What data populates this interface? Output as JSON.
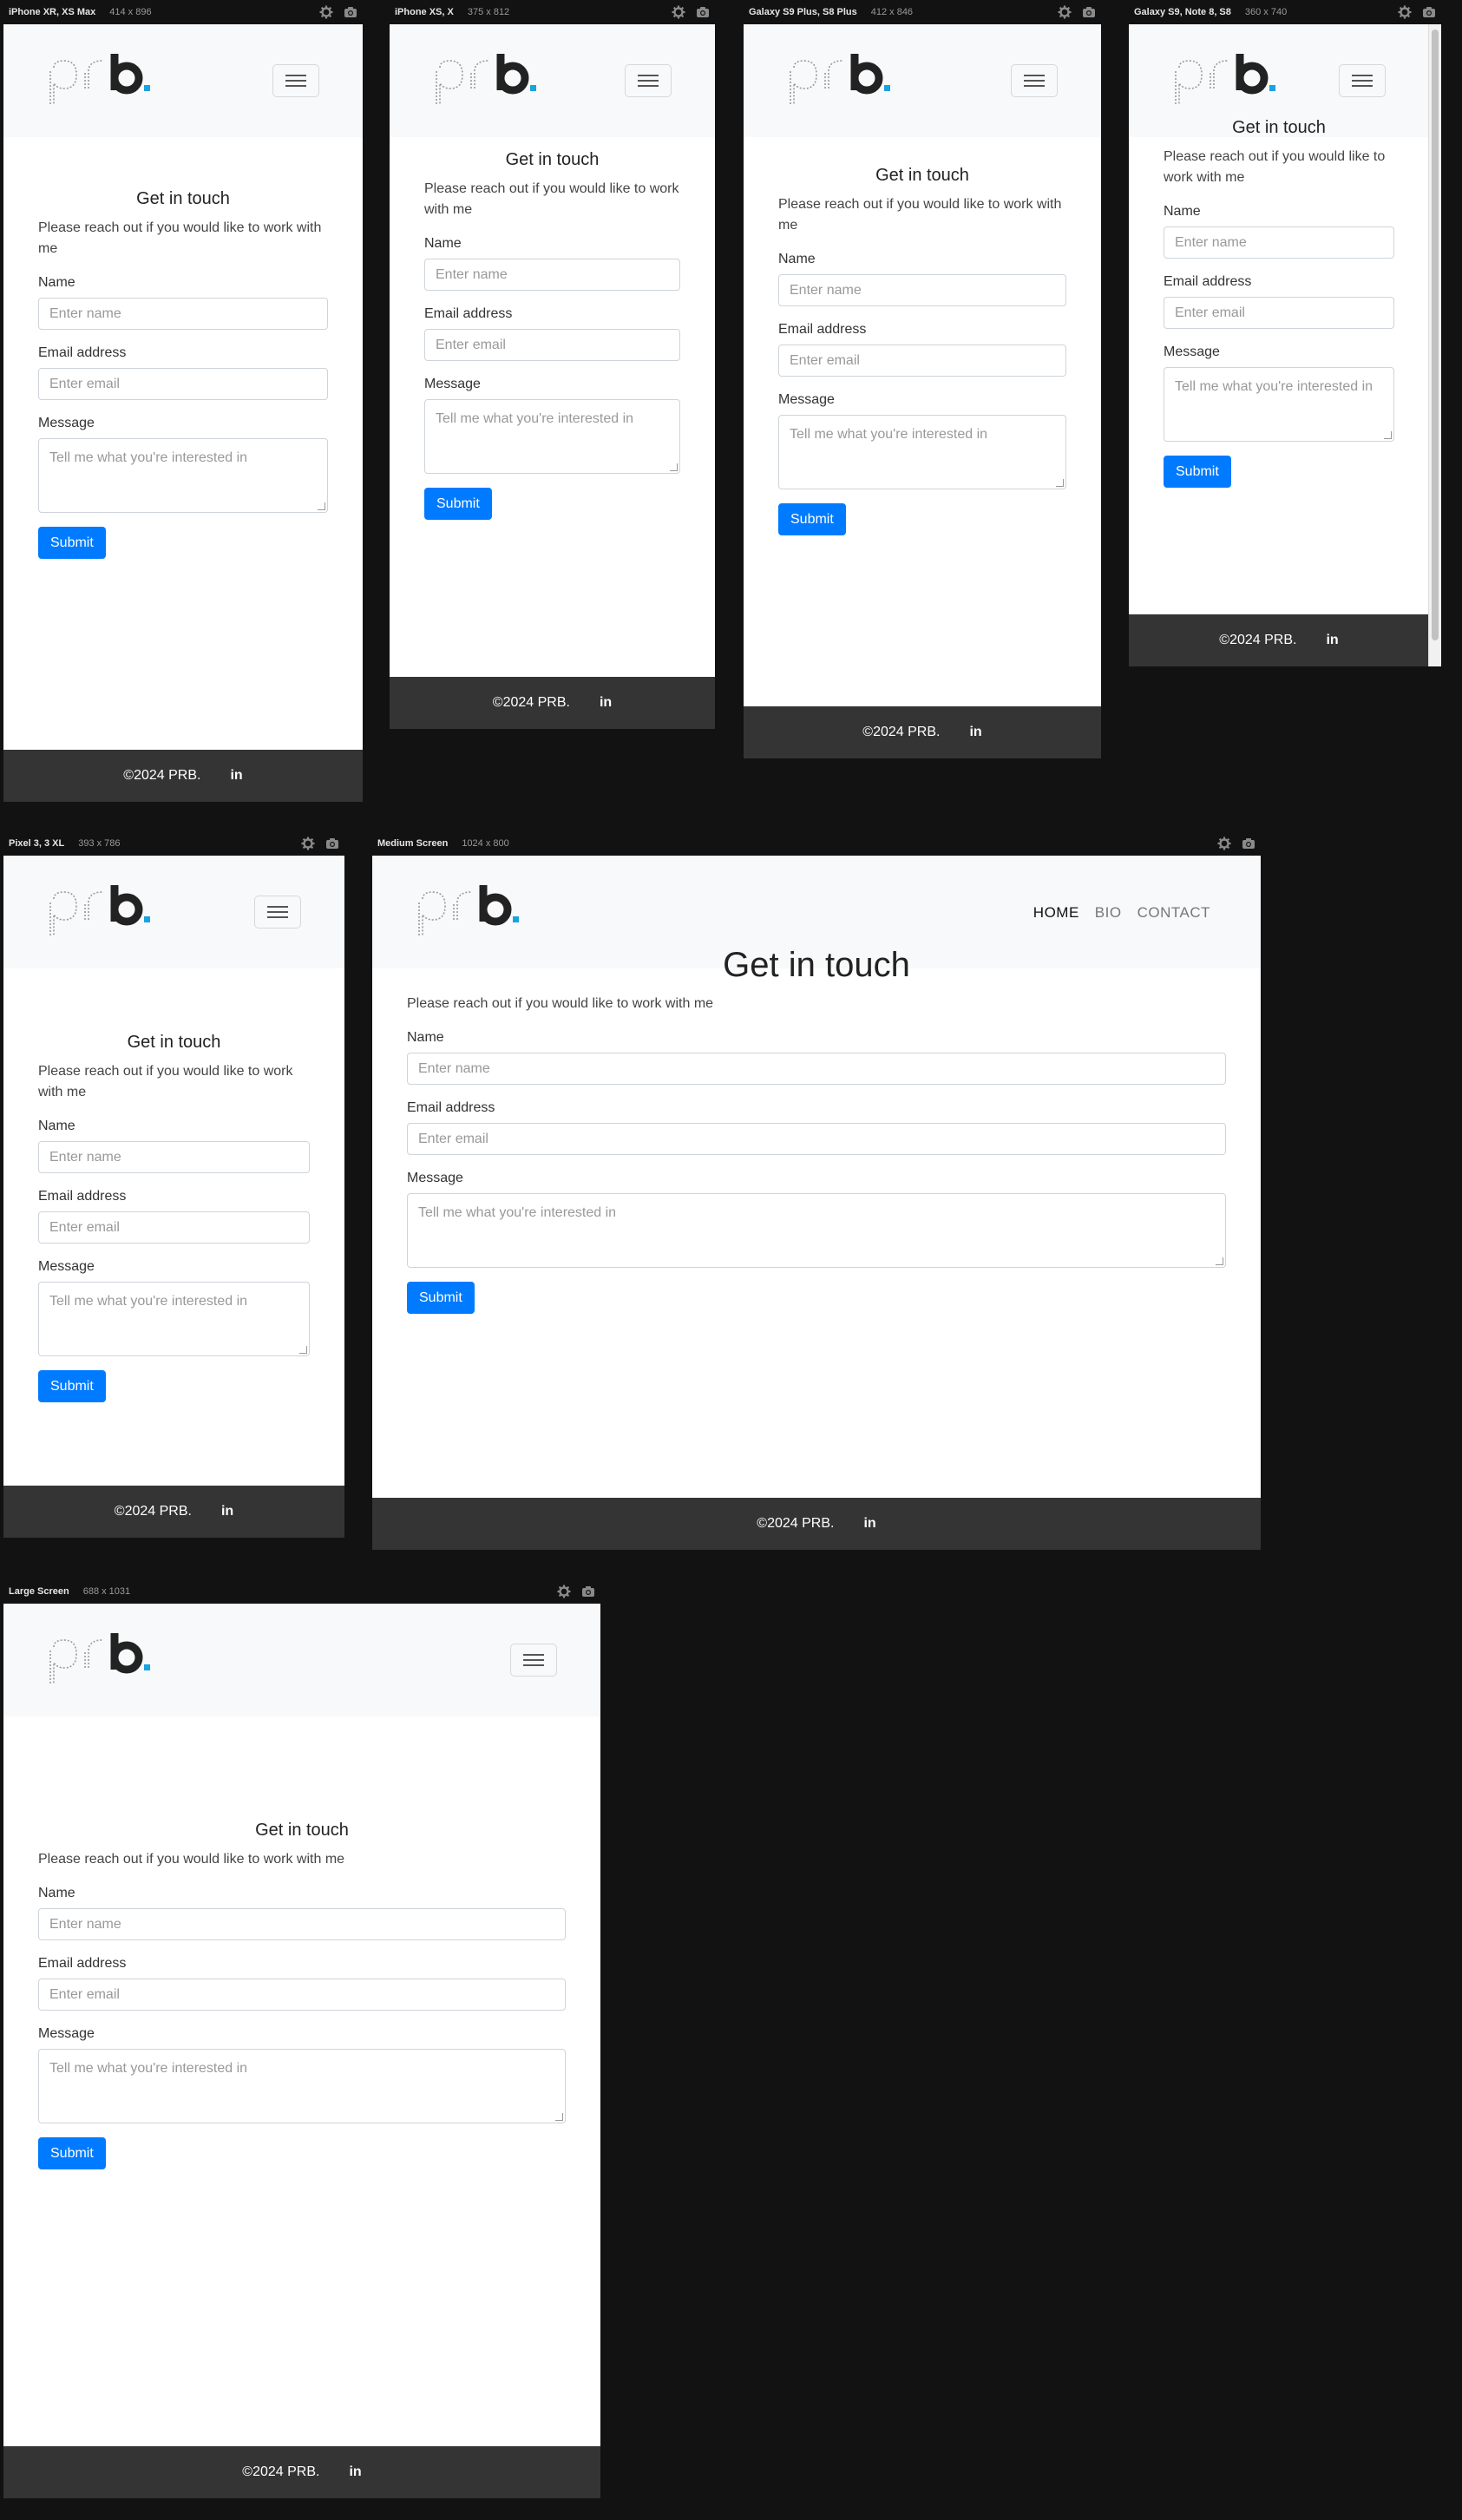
{
  "devices": [
    {
      "name": "iPhone XR, XS Max",
      "dims": "414 x 896"
    },
    {
      "name": "iPhone XS, X",
      "dims": "375 x 812"
    },
    {
      "name": "Galaxy S9 Plus, S8 Plus",
      "dims": "412 x 846"
    },
    {
      "name": "Galaxy S9, Note 8, S8",
      "dims": "360 x 740"
    },
    {
      "name": "Pixel 3, 3 XL",
      "dims": "393 x 786"
    },
    {
      "name": "Medium Screen",
      "dims": "1024 x 800"
    },
    {
      "name": "Large Screen",
      "dims": "688 x 1031"
    }
  ],
  "nav": {
    "links": [
      "HOME",
      "BIO",
      "CONTACT"
    ]
  },
  "contact": {
    "title": "Get in touch",
    "subtitle": "Please reach out if you would like to work with me",
    "name_label": "Name",
    "name_placeholder": "Enter name",
    "email_label": "Email address",
    "email_placeholder": "Enter email",
    "message_label": "Message",
    "message_placeholder": "Tell me what you're interested in",
    "submit": "Submit"
  },
  "footer": {
    "copyright": "©2024 PRB.",
    "linkedin": "in"
  },
  "icons": {
    "settings": "gear-icon",
    "screenshot": "camera-icon",
    "menu": "hamburger-icon",
    "social": "linkedin-icon"
  },
  "colors": {
    "background": "#121212",
    "navbar": "#f8f9fa",
    "footer": "#343434",
    "accent": "#007bff",
    "logo_dot": "#1aa3df"
  }
}
